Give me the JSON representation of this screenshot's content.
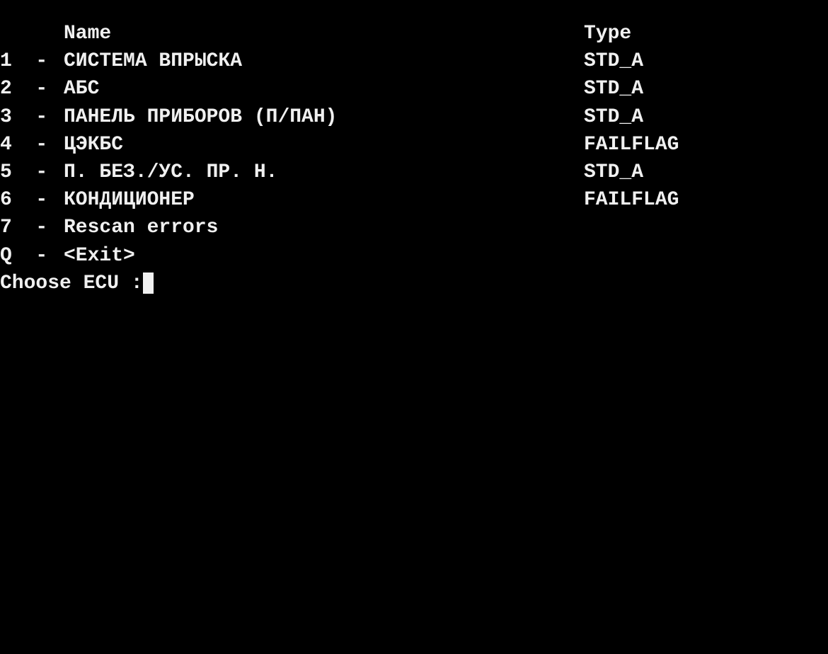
{
  "header": {
    "key": "",
    "name": "Name",
    "type": "Type"
  },
  "rows": [
    {
      "key": "1",
      "sep": "  - ",
      "name": "СИСТЕМА ВПРЫСКА",
      "type": "STD_A"
    },
    {
      "key": "2",
      "sep": "  - ",
      "name": "АБС",
      "type": "STD_A"
    },
    {
      "key": "3",
      "sep": "  - ",
      "name": "ПАНЕЛЬ ПРИБОРОВ (П/ПАН)",
      "type": "STD_A"
    },
    {
      "key": "4",
      "sep": "  - ",
      "name": "ЦЭКБС",
      "type": "FAILFLAG"
    },
    {
      "key": "5",
      "sep": "  - ",
      "name": "П. БЕЗ./УС. ПР. Н.",
      "type": "STD_A"
    },
    {
      "key": "6",
      "sep": "  - ",
      "name": "КОНДИЦИОНЕР",
      "type": "FAILFLAG"
    },
    {
      "key": "7",
      "sep": "  - ",
      "name": "Rescan errors",
      "type": ""
    },
    {
      "key": "Q",
      "sep": "  - ",
      "name": "<Exit>",
      "type": ""
    }
  ],
  "prompt": "Choose ECU :"
}
